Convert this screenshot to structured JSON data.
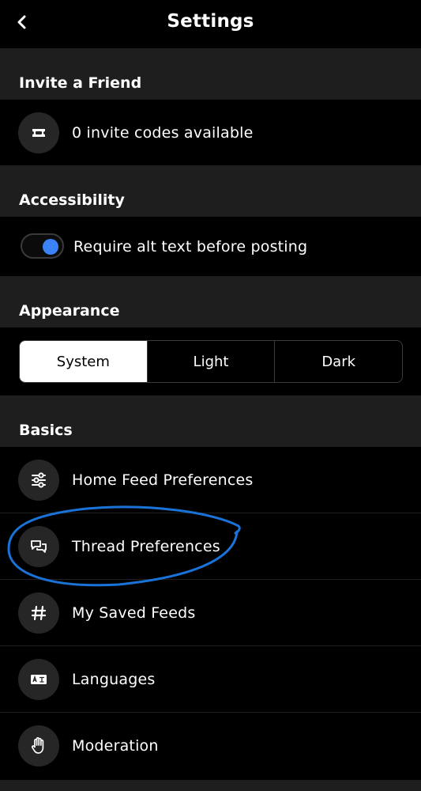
{
  "header": {
    "title": "Settings",
    "back_icon": "chevron-left-icon"
  },
  "sections": {
    "invite": {
      "title": "Invite a Friend",
      "row_label": "0 invite codes available",
      "icon": "ticket-icon"
    },
    "accessibility": {
      "title": "Accessibility",
      "toggle_label": "Require alt text before posting",
      "toggle_on": true,
      "accent": "#3b82f6"
    },
    "appearance": {
      "title": "Appearance",
      "options": [
        "System",
        "Light",
        "Dark"
      ],
      "selected": "System"
    },
    "basics": {
      "title": "Basics",
      "items": [
        {
          "label": "Home Feed Preferences",
          "icon": "sliders-icon"
        },
        {
          "label": "Thread Preferences",
          "icon": "chat-bubbles-icon"
        },
        {
          "label": "My Saved Feeds",
          "icon": "hashtag-icon"
        },
        {
          "label": "Languages",
          "icon": "language-icon"
        },
        {
          "label": "Moderation",
          "icon": "hand-icon"
        }
      ]
    }
  },
  "annotation": {
    "color": "#1a73d9",
    "target": "Thread Preferences"
  }
}
